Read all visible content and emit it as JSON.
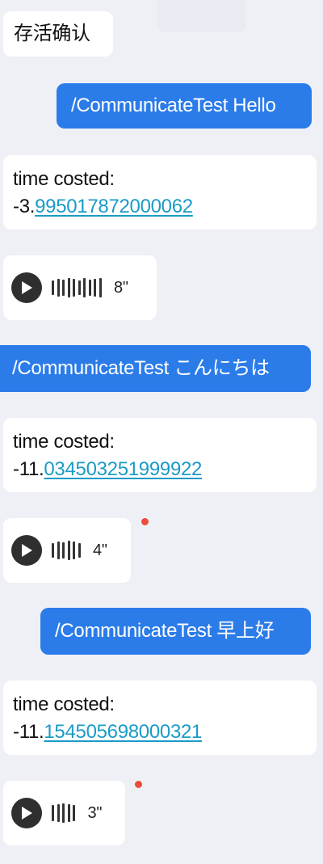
{
  "messages": {
    "m1": {
      "text": "存活确认"
    },
    "m2": {
      "text": "/CommunicateTest Hello"
    },
    "m3": {
      "line1": "time costed:",
      "prefix": "-3.",
      "link": "995017872000062"
    },
    "m4": {
      "duration": "8\""
    },
    "m5": {
      "text": "/CommunicateTest こんにちは"
    },
    "m6": {
      "line1": "time costed:",
      "prefix": "-11.",
      "link": "034503251999922"
    },
    "m7": {
      "duration": "4\""
    },
    "m8": {
      "text": "/CommunicateTest 早上好"
    },
    "m9": {
      "line1": "time costed:",
      "prefix": "-11.",
      "link": "154505698000321"
    },
    "m10": {
      "duration": "3\""
    }
  },
  "icons": {
    "play": "play-icon",
    "wave": "voice-waveform-icon",
    "unread": "unread-dot"
  },
  "colors": {
    "background": "#eef0f6",
    "incoming": "#ffffff",
    "outgoing": "#2b7ce9",
    "link": "#1a9bc7",
    "unread_dot": "#ef4b3a"
  }
}
